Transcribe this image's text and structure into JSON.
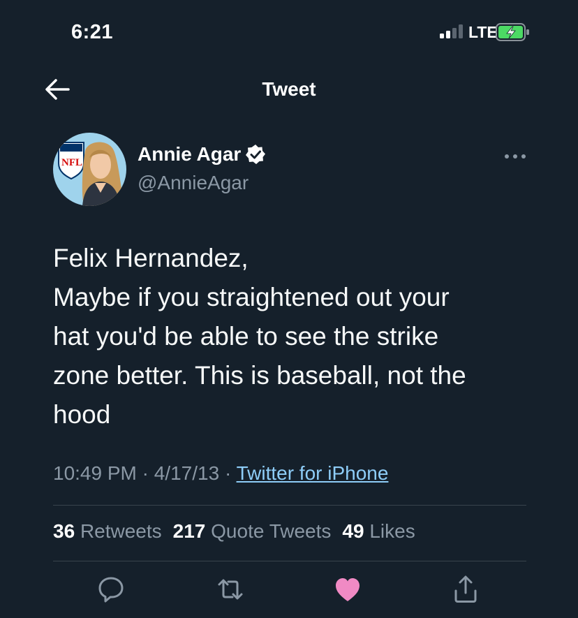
{
  "status_bar": {
    "time": "6:21",
    "network": "LTE",
    "icons": [
      "signal-icon",
      "battery-charging-icon"
    ]
  },
  "header": {
    "title": "Tweet",
    "back_icon": "arrow-left-icon"
  },
  "tweet": {
    "author": {
      "name": "Annie Agar",
      "handle": "@AnnieAgar",
      "verified": true,
      "avatar_icon": "nfl-profile-avatar"
    },
    "text_lines": [
      "Felix Hernandez,",
      "Maybe if you straightened out your",
      "hat you'd be able to see the strike",
      "zone better. This is baseball, not the",
      "hood"
    ],
    "time": "10:49 PM",
    "date": "4/17/13",
    "separator": "·",
    "source": "Twitter for iPhone",
    "stats": {
      "retweets_count": "36",
      "retweets_label": "Retweets",
      "quotes_count": "217",
      "quotes_label": "Quote Tweets",
      "likes_count": "49",
      "likes_label": "Likes"
    },
    "liked": true
  },
  "actions": [
    "reply-icon",
    "retweet-icon",
    "like-icon",
    "share-icon"
  ],
  "colors": {
    "background": "#15202b",
    "link": "#8ecdf8",
    "secondary_text": "#8b98a5",
    "like_active": "#f08ac4",
    "battery_charge": "#4cd964"
  }
}
